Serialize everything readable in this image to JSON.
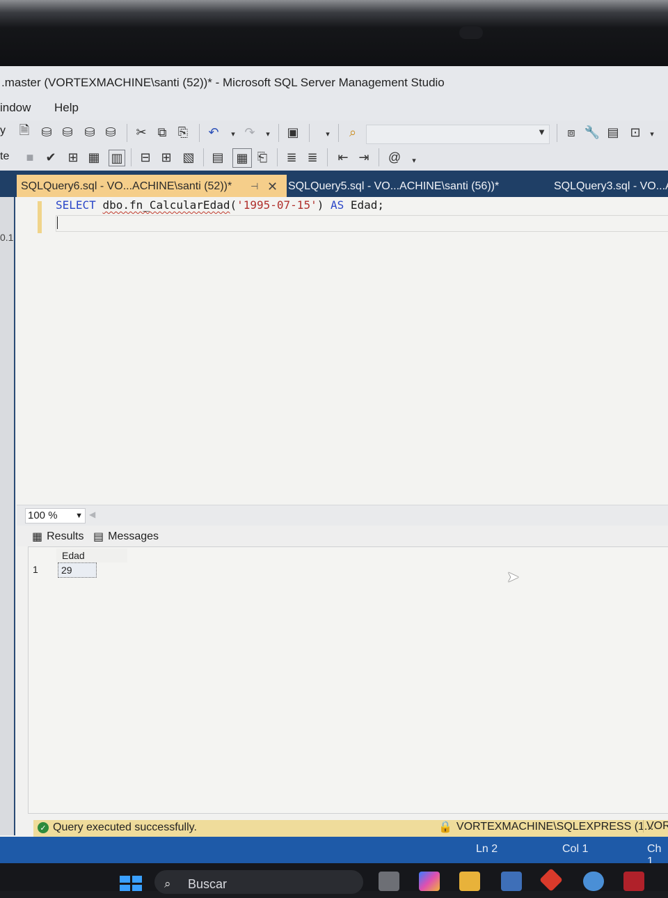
{
  "window": {
    "title": ".master (VORTEXMACHINE\\santi (52))* - Microsoft SQL Server Management Studio"
  },
  "menu": {
    "items": [
      "indow",
      "Help"
    ]
  },
  "toolbar1": {
    "left_fragment": "y"
  },
  "toolbar2": {
    "left_fragment": "te"
  },
  "tabs": [
    {
      "label": "SQLQuery6.sql - VO...ACHINE\\santi (52))*",
      "active": true
    },
    {
      "label": "SQLQuery5.sql - VO...ACHINE\\santi (56))*",
      "active": false
    },
    {
      "label": "SQLQuery3.sql - VO...A",
      "active": false
    }
  ],
  "left_panel": {
    "label": "0.1"
  },
  "editor": {
    "line1": {
      "kw_select": "SELECT",
      "fn": "dbo.fn_CalcularEdad",
      "open": "(",
      "arg": "'1995-07-15'",
      "close": ")",
      "kw_as": "AS",
      "alias": "Edad;"
    }
  },
  "zoom": {
    "value": "100 %"
  },
  "results_tabs": {
    "results": "Results",
    "messages": "Messages"
  },
  "grid": {
    "columns": [
      "Edad"
    ],
    "rows": [
      {
        "num": "1",
        "values": [
          "29"
        ]
      }
    ]
  },
  "query_status": {
    "message": "Query executed successfully.",
    "server": "VORTEXMACHINE\\SQLEXPRESS (1...",
    "server2": "VOR"
  },
  "app_status": {
    "ln": "Ln 2",
    "col": "Col 1",
    "ch": "Ch 1"
  },
  "taskbar": {
    "search_placeholder": "Buscar"
  },
  "colors": {
    "tab_active": "#f5ce8a",
    "tabstrip": "#1f3f66",
    "statusbar": "#1e5aa8",
    "query_ok_bar": "#efdc9b"
  }
}
